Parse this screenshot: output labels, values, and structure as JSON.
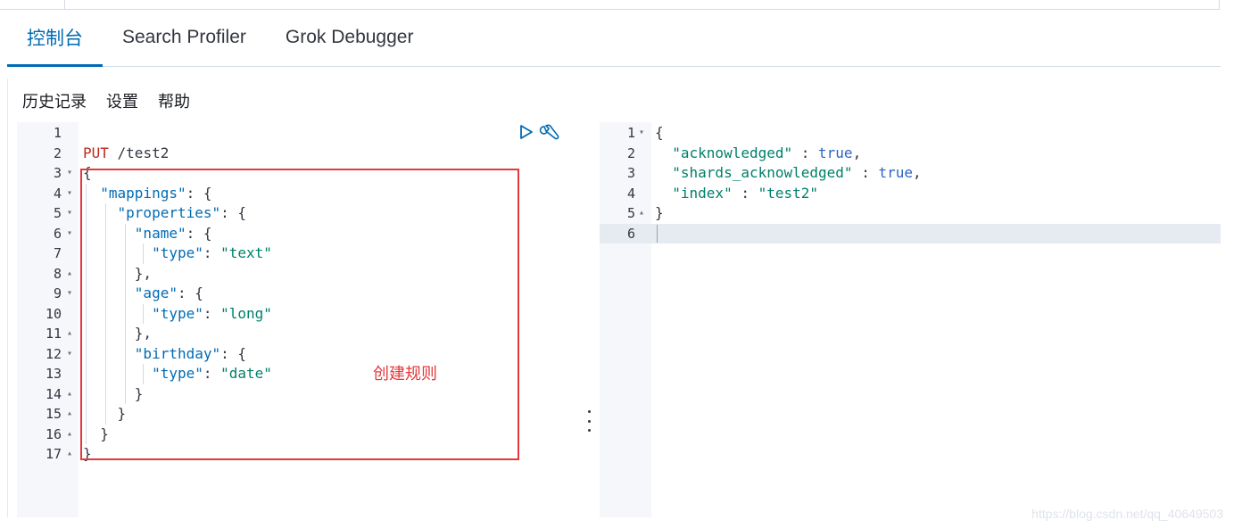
{
  "tabs": [
    {
      "label": "控制台",
      "selected": true
    },
    {
      "label": "Search Profiler",
      "selected": false
    },
    {
      "label": "Grok Debugger",
      "selected": false
    }
  ],
  "menu": [
    "历史记录",
    "设置",
    "帮助"
  ],
  "icons": {
    "run": "play-icon",
    "settings": "wrench-icon"
  },
  "colors": {
    "accent": "#006bb4",
    "annotation": "#e5383b",
    "string": "#00806b",
    "method": "#bd271e"
  },
  "request_editor": {
    "lines": [
      {
        "n": "1",
        "fold": "",
        "tokens": []
      },
      {
        "n": "2",
        "fold": "",
        "tokens": [
          [
            "method",
            "PUT"
          ],
          [
            "path",
            " /test2"
          ]
        ]
      },
      {
        "n": "3",
        "fold": "▾",
        "tokens": [
          [
            "punc",
            "{"
          ]
        ]
      },
      {
        "n": "4",
        "fold": "▾",
        "tokens": [
          [
            "punc",
            "  "
          ],
          [
            "key",
            "\"mappings\""
          ],
          [
            "punc",
            ": {"
          ]
        ]
      },
      {
        "n": "5",
        "fold": "▾",
        "tokens": [
          [
            "punc",
            "    "
          ],
          [
            "key",
            "\"properties\""
          ],
          [
            "punc",
            ": {"
          ]
        ]
      },
      {
        "n": "6",
        "fold": "▾",
        "tokens": [
          [
            "punc",
            "      "
          ],
          [
            "key",
            "\"name\""
          ],
          [
            "punc",
            ": {"
          ]
        ]
      },
      {
        "n": "7",
        "fold": "",
        "tokens": [
          [
            "punc",
            "        "
          ],
          [
            "key",
            "\"type\""
          ],
          [
            "punc",
            ": "
          ],
          [
            "str",
            "\"text\""
          ]
        ]
      },
      {
        "n": "8",
        "fold": "▴",
        "tokens": [
          [
            "punc",
            "      },"
          ]
        ]
      },
      {
        "n": "9",
        "fold": "▾",
        "tokens": [
          [
            "punc",
            "      "
          ],
          [
            "key",
            "\"age\""
          ],
          [
            "punc",
            ": {"
          ]
        ]
      },
      {
        "n": "10",
        "fold": "",
        "tokens": [
          [
            "punc",
            "        "
          ],
          [
            "key",
            "\"type\""
          ],
          [
            "punc",
            ": "
          ],
          [
            "str",
            "\"long\""
          ]
        ]
      },
      {
        "n": "11",
        "fold": "▴",
        "tokens": [
          [
            "punc",
            "      },"
          ]
        ]
      },
      {
        "n": "12",
        "fold": "▾",
        "tokens": [
          [
            "punc",
            "      "
          ],
          [
            "key",
            "\"birthday\""
          ],
          [
            "punc",
            ": {"
          ]
        ]
      },
      {
        "n": "13",
        "fold": "",
        "tokens": [
          [
            "punc",
            "        "
          ],
          [
            "key",
            "\"type\""
          ],
          [
            "punc",
            ": "
          ],
          [
            "str",
            "\"date\""
          ]
        ]
      },
      {
        "n": "14",
        "fold": "▴",
        "tokens": [
          [
            "punc",
            "      }"
          ]
        ]
      },
      {
        "n": "15",
        "fold": "▴",
        "tokens": [
          [
            "punc",
            "    }"
          ]
        ]
      },
      {
        "n": "16",
        "fold": "▴",
        "tokens": [
          [
            "punc",
            "  }"
          ]
        ]
      },
      {
        "n": "17",
        "fold": "▴",
        "tokens": [
          [
            "punc",
            "}"
          ]
        ]
      }
    ]
  },
  "response_editor": {
    "lines": [
      {
        "n": "1",
        "fold": "▾",
        "tokens": [
          [
            "punc",
            "{"
          ]
        ]
      },
      {
        "n": "2",
        "fold": "",
        "tokens": [
          [
            "punc",
            "  "
          ],
          [
            "str",
            "\"acknowledged\""
          ],
          [
            "punc",
            " : "
          ],
          [
            "bool",
            "true"
          ],
          [
            "punc",
            ","
          ]
        ]
      },
      {
        "n": "3",
        "fold": "",
        "tokens": [
          [
            "punc",
            "  "
          ],
          [
            "str",
            "\"shards_acknowledged\""
          ],
          [
            "punc",
            " : "
          ],
          [
            "bool",
            "true"
          ],
          [
            "punc",
            ","
          ]
        ]
      },
      {
        "n": "4",
        "fold": "",
        "tokens": [
          [
            "punc",
            "  "
          ],
          [
            "str",
            "\"index\""
          ],
          [
            "punc",
            " : "
          ],
          [
            "str",
            "\"test2\""
          ]
        ]
      },
      {
        "n": "5",
        "fold": "▴",
        "tokens": [
          [
            "punc",
            "}"
          ]
        ]
      },
      {
        "n": "6",
        "fold": "",
        "tokens": []
      }
    ]
  },
  "annotation": "创建规则",
  "watermark": "https://blog.csdn.net/qq_40649503"
}
